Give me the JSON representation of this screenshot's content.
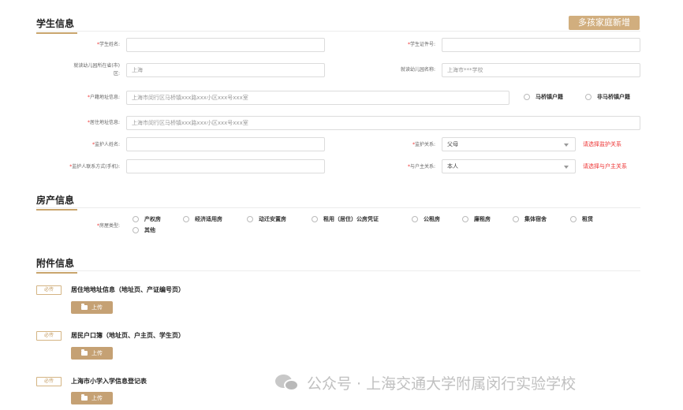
{
  "student": {
    "title": "学生信息",
    "add_family": "多孩家庭新增",
    "name_label": "学生姓名:",
    "id_label": "学生证件号:",
    "kg_district_label": "就读幼儿园所在省(市)区:",
    "kg_district_value": "上海",
    "kg_name_label": "就读幼儿园名称:",
    "kg_name_placeholder": "上海市***学校",
    "hukou_label": "户籍地址信息:",
    "hukou_placeholder": "上海市闵行区马桥镇xxx路xxx小区xxx号xxx室",
    "maqiao_hukou": "马桥镇户籍",
    "non_maqiao_hukou": "非马桥镇户籍",
    "residence_label": "居住地址信息:",
    "residence_placeholder": "上海市闵行区马桥镇xxx路xxx小区xxx号xxx室",
    "guardian_name_label": "监护人姓名:",
    "relation_label": "监护关系:",
    "relation_value": "父母",
    "relation_hint": "请选择监护关系",
    "guardian_phone_label": "监护人联系方式(手机):",
    "head_relation_label": "与户主关系:",
    "head_relation_value": "本人",
    "head_relation_hint": "请选择与户主关系"
  },
  "property": {
    "title": "房产信息",
    "type_label": "房屋类型:",
    "options": [
      "产权房",
      "经济适用房",
      "动迁安置房",
      "租用（居住）公房凭证",
      "公租房",
      "廉租房",
      "集体宿舍",
      "租赁",
      "其他"
    ]
  },
  "attachments": {
    "title": "附件信息",
    "required_tag": "必传",
    "upload_label": "上传",
    "items": [
      {
        "title": "居住地地址信息（地址页、产证编号页）"
      },
      {
        "title": "居民户口簿（地址页、户主页、学生页）"
      },
      {
        "title": "上海市小学入学信息登记表"
      }
    ]
  },
  "watermark": {
    "text": "公众号 · 上海交通大学附属闵行实验学校"
  },
  "colors": {
    "accent": "#c9a56d",
    "required": "#e33333",
    "hint": "#e33333"
  }
}
